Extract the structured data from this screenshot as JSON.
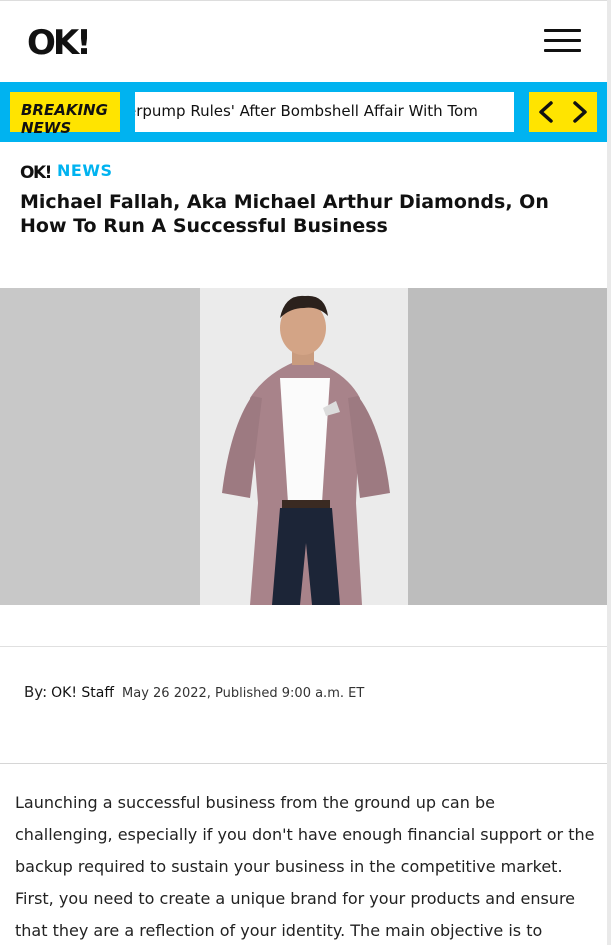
{
  "header": {
    "logo_text": "OK!",
    "menu_icon": "hamburger-menu-icon"
  },
  "ticker": {
    "label_line1": "BREAKING",
    "label_line2": "NEWS",
    "headline": "erpump Rules' After Bombshell Affair With Tom",
    "prev_icon": "chevron-left-icon",
    "next_icon": "chevron-right-icon",
    "bg_color": "#00b3f0",
    "accent_color": "#ffe400"
  },
  "article": {
    "section_logo": "OK!",
    "section_label": "NEWS",
    "title": "Michael Fallah, Aka Michael Arthur Diamonds, On How To Run A Successful Business",
    "byline_prefix": "By:",
    "author": "OK! Staff",
    "date": "May 26 2022, Published 9:00 a.m. ET",
    "body": "Launching a successful business from the ground up can be challenging, especially if you don't have enough financial support or the backup required to sustain your business in the competitive market. First, you need to create a unique brand for your products and ensure that they are a reflection of your identity. The main objective is to"
  }
}
